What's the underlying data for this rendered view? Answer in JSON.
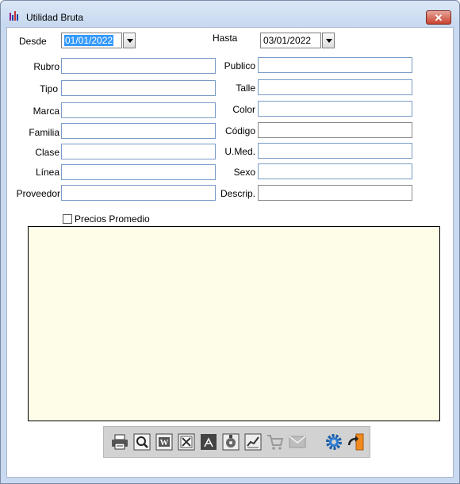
{
  "window": {
    "title": "Utilidad Bruta",
    "close_glyph": "✕"
  },
  "dates": {
    "desde_label": "Desde",
    "desde_value": "01/01/2022",
    "hasta_label": "Hasta",
    "hasta_value": "03/01/2022"
  },
  "filters_left": [
    {
      "label": "Rubro",
      "value": ""
    },
    {
      "label": "Tipo",
      "value": ""
    },
    {
      "label": "Marca",
      "value": ""
    },
    {
      "label": "Familia",
      "value": ""
    },
    {
      "label": "Clase",
      "value": ""
    },
    {
      "label": "Línea",
      "value": ""
    },
    {
      "label": "Proveedor",
      "value": ""
    }
  ],
  "filters_right": [
    {
      "label": "Publico",
      "value": ""
    },
    {
      "label": "Talle",
      "value": ""
    },
    {
      "label": "Color",
      "value": ""
    },
    {
      "label": "Código",
      "value": ""
    },
    {
      "label": "U.Med.",
      "value": ""
    },
    {
      "label": "Sexo",
      "value": ""
    },
    {
      "label": "Descrip.",
      "value": ""
    }
  ],
  "options": {
    "precios_promedio_label": "Precios Promedio",
    "precios_promedio_checked": false
  },
  "toolbar": {
    "buttons": [
      {
        "name": "printer-icon",
        "enabled": true
      },
      {
        "name": "print-preview-icon",
        "enabled": true
      },
      {
        "name": "word-export-icon",
        "enabled": true
      },
      {
        "name": "excel-export-icon",
        "enabled": true
      },
      {
        "name": "pdf-export-icon",
        "enabled": true
      },
      {
        "name": "disk-export-icon",
        "enabled": true
      },
      {
        "name": "chart-icon",
        "enabled": true
      },
      {
        "name": "cart-icon",
        "enabled": false
      },
      {
        "name": "email-icon",
        "enabled": false
      },
      {
        "name": "gear-icon",
        "enabled": true
      },
      {
        "name": "exit-door-icon",
        "enabled": true
      }
    ]
  },
  "colors": {
    "grid_bg": "#fdfde8",
    "selection": "#3399ff",
    "field_border": "#7a9cc8"
  }
}
